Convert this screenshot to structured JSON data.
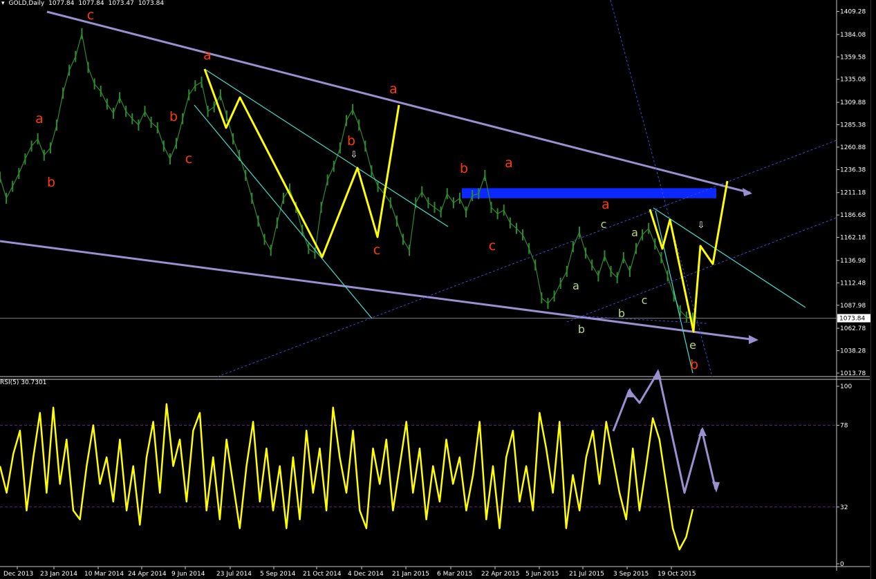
{
  "header": {
    "symbol": "GOLD,Daily",
    "open": "1077.84",
    "high": "1077.84",
    "low": "1073.47",
    "close": "1073.84"
  },
  "rsi_header": {
    "label": "RSI(5) 30.7301"
  },
  "colors": {
    "background": "#000000",
    "price_bars": "#2e8b2e",
    "wave_yellow": "#ffff00",
    "channel_purple": "#9a90d0",
    "channel_cyan": "#40e0d0",
    "label_red": "#ff3b00",
    "label_green": "#b8d878",
    "resistance_blue": "#0a28ff",
    "rsi_line": "#ffff00"
  },
  "chart_data": [
    {
      "type": "line",
      "panel": "price",
      "title": "GOLD,Daily",
      "y_ticks": [
        "1409.28",
        "1384.08",
        "1359.58",
        "1335.08",
        "1309.88",
        "1285.38",
        "1260.88",
        "1236.38",
        "1211.18",
        "1186.68",
        "1162.18",
        "1136.98",
        "1112.48",
        "1087.98",
        "1062.78",
        "1038.28",
        "1013.78"
      ],
      "ylim": [
        1010,
        1418
      ],
      "current_price": "1073.84",
      "x_ticks": [
        "Dec 2013",
        "23 Jan 2014",
        "10 Mar 2014",
        "24 Apr 2014",
        "9 Jun 2014",
        "23 Jul 2014",
        "5 Sep 2014",
        "21 Oct 2014",
        "4 Dec 2014",
        "21 Jan 2015",
        "6 Mar 2015",
        "22 Apr 2015",
        "5 Jun 2015",
        "21 Jul 2015",
        "3 Sep 2015",
        "19 Oct 2015"
      ],
      "series": [
        {
          "values": [
            1228,
            1205,
            1218,
            1232,
            1248,
            1262,
            1270,
            1252,
            1260,
            1285,
            1320,
            1345,
            1360,
            1385,
            1348,
            1330,
            1322,
            1308,
            1298,
            1315,
            1300,
            1292,
            1285,
            1300,
            1288,
            1282,
            1262,
            1248,
            1265,
            1292,
            1318,
            1328,
            1332,
            1300,
            1305,
            1318,
            1295,
            1270,
            1252,
            1230,
            1205,
            1180,
            1160,
            1148,
            1178,
            1205,
            1215,
            1195,
            1170,
            1150,
            1145,
            1195,
            1225,
            1240,
            1260,
            1290,
            1302,
            1285,
            1262,
            1235,
            1218,
            1210,
            1200,
            1180,
            1160,
            1148,
            1200,
            1212,
            1200,
            1195,
            1190,
            1210,
            1200,
            1205,
            1190,
            1208,
            1210,
            1230,
            1195,
            1188,
            1192,
            1178,
            1172,
            1165,
            1150,
            1132,
            1096,
            1090,
            1098,
            1112,
            1125,
            1152,
            1168,
            1145,
            1132,
            1120,
            1142,
            1125,
            1118,
            1140,
            1125,
            1150,
            1165,
            1172,
            1155,
            1140,
            1120,
            1098,
            1082,
            1075,
            1073.84
          ]
        }
      ],
      "wave_labels": [
        {
          "text": "c",
          "color": "red"
        },
        {
          "text": "a",
          "color": "red"
        },
        {
          "text": "b",
          "color": "red"
        },
        {
          "text": "a",
          "color": "red"
        },
        {
          "text": "b",
          "color": "red"
        },
        {
          "text": "c",
          "color": "red"
        },
        {
          "text": "a",
          "color": "red"
        },
        {
          "text": "b",
          "color": "red"
        },
        {
          "text": "c",
          "color": "red"
        },
        {
          "text": "a",
          "color": "red"
        },
        {
          "text": "b",
          "color": "red"
        },
        {
          "text": "c",
          "color": "red"
        },
        {
          "text": "a",
          "color": "red"
        },
        {
          "text": "b",
          "color": "red"
        },
        {
          "text": "a",
          "color": "green"
        },
        {
          "text": "b",
          "color": "green"
        },
        {
          "text": "c",
          "color": "green"
        },
        {
          "text": "a",
          "color": "green"
        },
        {
          "text": "c",
          "color": "green"
        },
        {
          "text": "b",
          "color": "green"
        },
        {
          "text": "e",
          "color": "green"
        }
      ],
      "resistance_zone": [
        1205,
        1216
      ]
    },
    {
      "type": "line",
      "panel": "rsi",
      "title": "RSI(5) 30.7301",
      "y_ticks": [
        "100",
        "78",
        "32",
        "0"
      ],
      "ylim": [
        0,
        100
      ],
      "levels": [
        78,
        32
      ],
      "series": [
        {
          "values": [
            55,
            40,
            62,
            75,
            30,
            60,
            85,
            40,
            88,
            45,
            70,
            30,
            25,
            55,
            78,
            45,
            60,
            35,
            70,
            30,
            55,
            22,
            60,
            80,
            40,
            90,
            55,
            70,
            35,
            75,
            85,
            30,
            60,
            25,
            70,
            45,
            20,
            55,
            80,
            35,
            65,
            30,
            55,
            20,
            60,
            25,
            75,
            40,
            65,
            30,
            88,
            60,
            40,
            75,
            30,
            20,
            65,
            45,
            70,
            30,
            55,
            80,
            40,
            65,
            25,
            55,
            35,
            70,
            45,
            60,
            30,
            50,
            80,
            25,
            55,
            20,
            60,
            75,
            35,
            55,
            30,
            85,
            65,
            40,
            80,
            20,
            50,
            30,
            60,
            75,
            45,
            80,
            60,
            40,
            25,
            65,
            30,
            55,
            82,
            70,
            45,
            20,
            8,
            15,
            30.73
          ]
        }
      ]
    }
  ],
  "arrows": [
    {
      "name": "down-arrow-1",
      "glyph": "⇩"
    },
    {
      "name": "down-arrow-2",
      "glyph": "⇩"
    }
  ]
}
